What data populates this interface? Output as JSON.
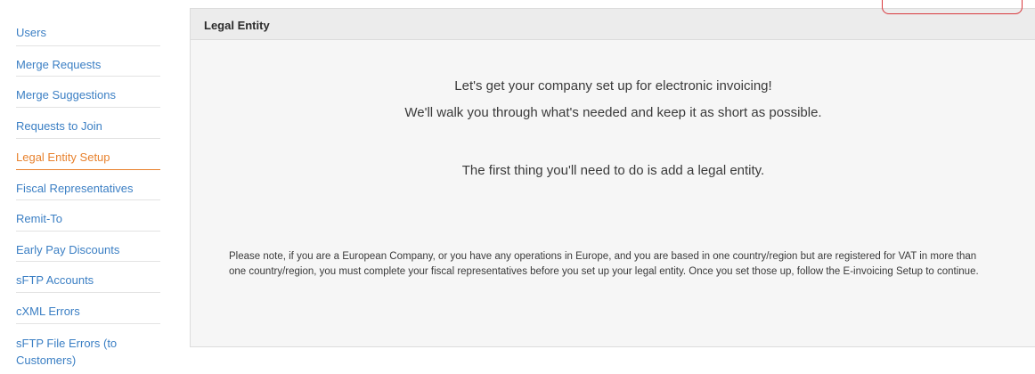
{
  "sidebar": {
    "items": [
      {
        "label": "Users",
        "active": false
      },
      {
        "label": "Merge Requests",
        "active": false
      },
      {
        "label": "Merge Suggestions",
        "active": false
      },
      {
        "label": "Requests to Join",
        "active": false
      },
      {
        "label": "Legal Entity Setup",
        "active": true
      },
      {
        "label": "Fiscal Representatives",
        "active": false
      },
      {
        "label": "Remit-To",
        "active": false
      },
      {
        "label": "Early Pay Discounts",
        "active": false
      },
      {
        "label": "sFTP Accounts",
        "active": false
      },
      {
        "label": "cXML Errors",
        "active": false
      },
      {
        "label": "sFTP File Errors (to Customers)",
        "active": false
      }
    ]
  },
  "panel": {
    "title": "Legal Entity",
    "intro_line1": "Let's get your company set up for electronic invoicing!",
    "intro_line2": "We'll walk you through what's needed and keep it as short as possible.",
    "first_step": "The first thing you'll need to do is add a legal entity.",
    "note": "Please note, if you are a European Company, or you have any operations in Europe, and you are based in one country/region but are registered for VAT in more than one country/region, you must complete your fiscal representatives before you set up your legal entity. Once you set those up, follow the E-invoicing Setup to continue."
  },
  "colors": {
    "link": "#3b7fc4",
    "active": "#e8822e",
    "highlight_box": "#d9393e"
  }
}
